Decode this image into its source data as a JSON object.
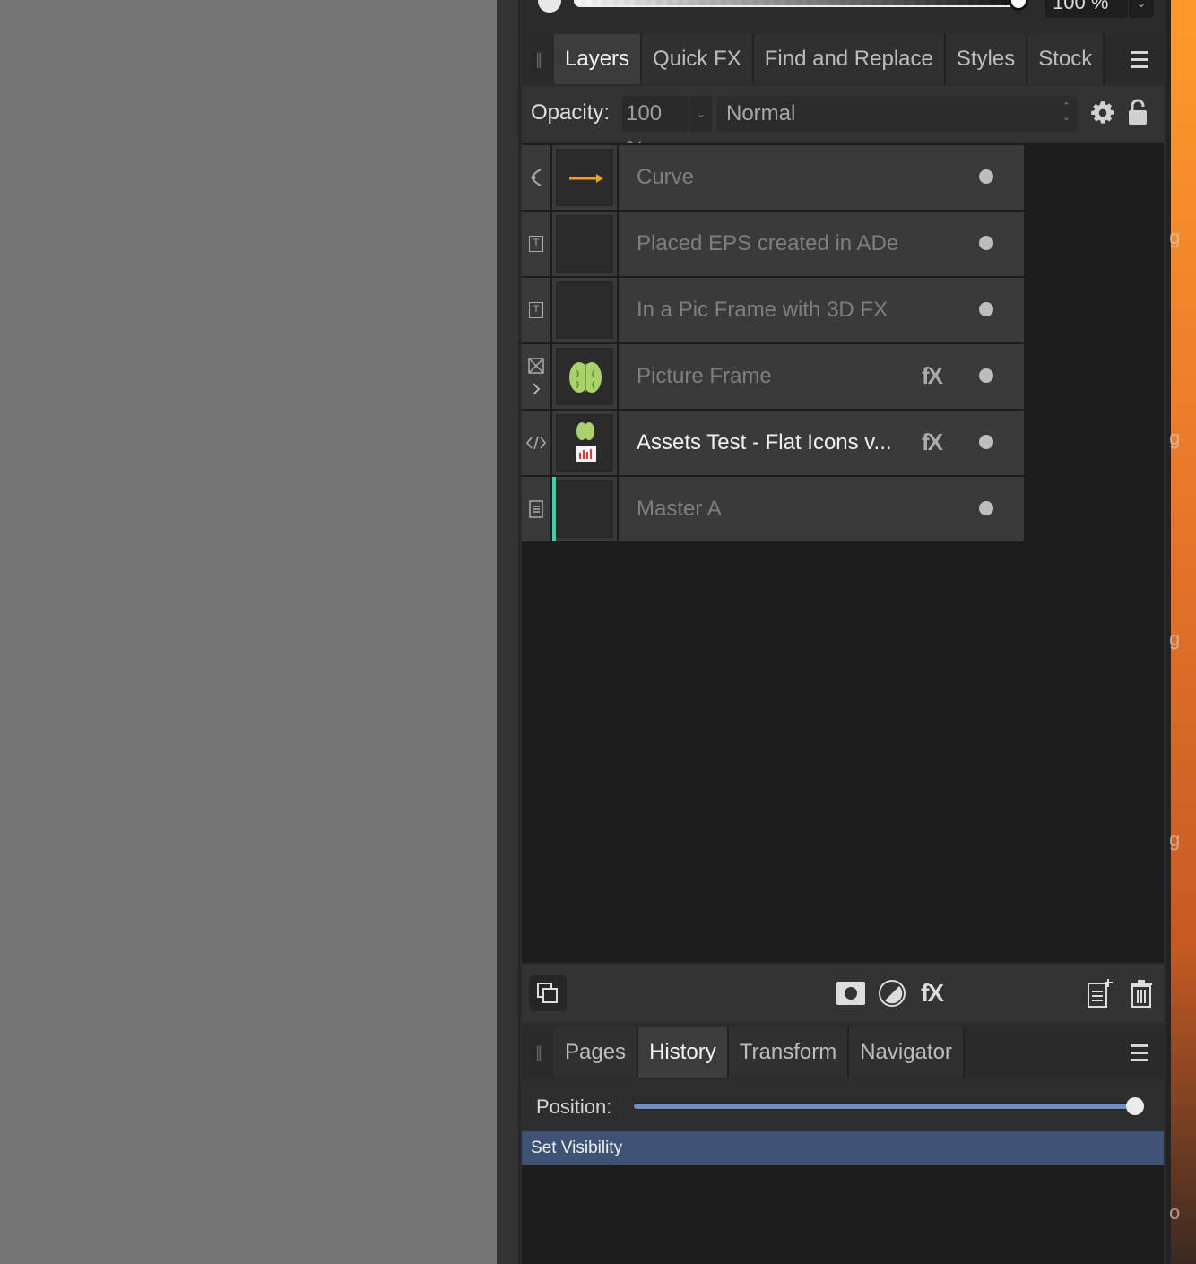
{
  "top_strip": {
    "opacity_value": "100 %",
    "dropdown_glyph": "⌄"
  },
  "layers_panel": {
    "grip_glyph": "||",
    "tabs": [
      {
        "label": "Layers",
        "active": true
      },
      {
        "label": "Quick FX",
        "active": false
      },
      {
        "label": "Find and Replace",
        "active": false
      },
      {
        "label": "Styles",
        "active": false
      },
      {
        "label": "Stock",
        "active": false
      }
    ],
    "opacity_label": "Opacity:",
    "opacity_value": "100 %",
    "blend_mode": "Normal",
    "layers": [
      {
        "name": "Curve",
        "type_icon": "curve-node-icon",
        "thumb": "orange-arrow",
        "fx": "",
        "selected": false
      },
      {
        "name": "Placed EPS created in ADe",
        "type_icon": "text-frame-icon",
        "thumb": "dark",
        "fx": "",
        "selected": false
      },
      {
        "name": "In a Pic Frame with 3D FX",
        "type_icon": "text-frame-icon",
        "thumb": "dark",
        "fx": "",
        "selected": false
      },
      {
        "name": "Picture Frame",
        "type_icon": "picture-frame-icon",
        "thumb": "brain",
        "fx": "fX",
        "selected": false
      },
      {
        "name": "Assets Test - Flat Icons v...",
        "type_icon": "embedded-code-icon",
        "thumb": "brain-chart",
        "fx": "fX",
        "selected": true
      },
      {
        "name": "Master A",
        "type_icon": "master-page-icon",
        "thumb": "blank",
        "fx": "",
        "selected": false
      }
    ],
    "footer_icons": [
      "arrange-icon",
      "mask-icon",
      "adjustment-icon",
      "fx-icon",
      "add-page-icon",
      "trash-icon"
    ],
    "fx_footer_label": "fX"
  },
  "history_panel": {
    "grip_glyph": "||",
    "tabs": [
      {
        "label": "Pages",
        "active": false
      },
      {
        "label": "History",
        "active": true
      },
      {
        "label": "Transform",
        "active": false
      },
      {
        "label": "Navigator",
        "active": false
      }
    ],
    "position_label": "Position:",
    "position_fraction": 1.0,
    "items": [
      "Set Visibility"
    ]
  },
  "colors": {
    "accent_selection": "#3d5274",
    "teal_marker": "#3fcfa8",
    "slider_fill": "#6e8fbf",
    "arrow_orange": "#f0a020"
  }
}
